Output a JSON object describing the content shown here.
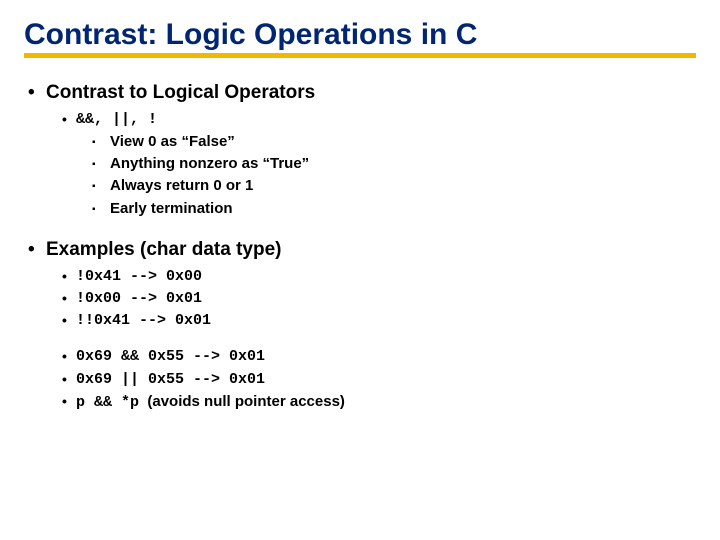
{
  "title": "Contrast: Logic Operations in C",
  "section1": {
    "heading": "Contrast to Logical Operators",
    "ops": "&&, ||, !",
    "props": [
      "View 0 as “False”",
      "Anything nonzero as “True”",
      "Always return 0 or 1",
      "Early termination"
    ]
  },
  "section2": {
    "heading": "Examples (char data type)",
    "ex_unary": [
      "!0x41  -->  0x00",
      "!0x00  -->  0x01",
      "!!0x41 -->  0x01"
    ],
    "ex_binary": [
      "0x69 && 0x55  -->  0x01",
      "0x69 || 0x55  -->  0x01"
    ],
    "ex_ptr_code": "p && *p",
    "ex_ptr_note": "  (avoids null pointer access)"
  }
}
